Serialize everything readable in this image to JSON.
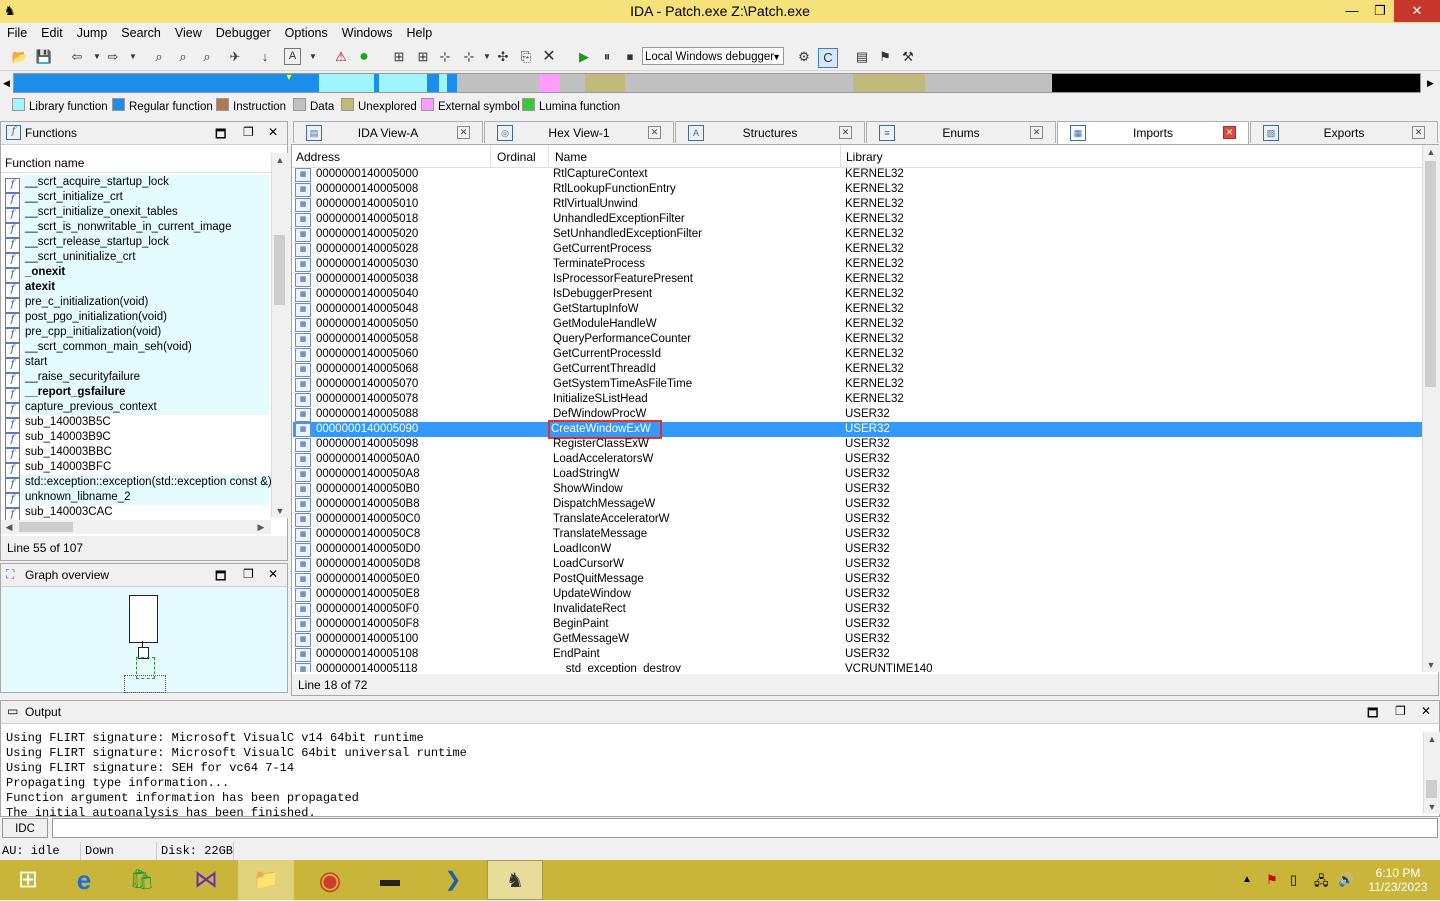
{
  "window": {
    "title": "IDA - Patch.exe Z:\\Patch.exe",
    "min": "—",
    "restore": "❐",
    "close": "✕"
  },
  "menu": [
    "File",
    "Edit",
    "Jump",
    "Search",
    "View",
    "Debugger",
    "Options",
    "Windows",
    "Help"
  ],
  "toolbar": {
    "debugger_select": "Local Windows debugger"
  },
  "legend": [
    {
      "label": "Library function",
      "color": "#9ff5ff"
    },
    {
      "label": "Regular function",
      "color": "#1a8ee8"
    },
    {
      "label": "Instruction",
      "color": "#b07a50"
    },
    {
      "label": "Data",
      "color": "#c0c0c0"
    },
    {
      "label": "Unexplored",
      "color": "#bfbb7a"
    },
    {
      "label": "External symbol",
      "color": "#ff9cff"
    },
    {
      "label": "Lumina function",
      "color": "#33cc33"
    }
  ],
  "functions_panel": {
    "title": "Functions",
    "column": "Function name",
    "items": [
      {
        "name": "__scrt_acquire_startup_lock",
        "bold": false,
        "lib": true
      },
      {
        "name": "__scrt_initialize_crt",
        "bold": false,
        "lib": true
      },
      {
        "name": "__scrt_initialize_onexit_tables",
        "bold": false,
        "lib": true
      },
      {
        "name": "__scrt_is_nonwritable_in_current_image",
        "bold": false,
        "lib": true
      },
      {
        "name": "__scrt_release_startup_lock",
        "bold": false,
        "lib": true
      },
      {
        "name": "__scrt_uninitialize_crt",
        "bold": false,
        "lib": true
      },
      {
        "name": "_onexit",
        "bold": true,
        "lib": true
      },
      {
        "name": "atexit",
        "bold": true,
        "lib": true
      },
      {
        "name": "pre_c_initialization(void)",
        "bold": false,
        "lib": true
      },
      {
        "name": "post_pgo_initialization(void)",
        "bold": false,
        "lib": true
      },
      {
        "name": "pre_cpp_initialization(void)",
        "bold": false,
        "lib": true
      },
      {
        "name": "__scrt_common_main_seh(void)",
        "bold": false,
        "lib": true
      },
      {
        "name": "start",
        "bold": false,
        "lib": true
      },
      {
        "name": "__raise_securityfailure",
        "bold": false,
        "lib": true
      },
      {
        "name": "__report_gsfailure",
        "bold": true,
        "lib": true
      },
      {
        "name": "capture_previous_context",
        "bold": false,
        "lib": true
      },
      {
        "name": "sub_140003B5C",
        "bold": false,
        "lib": false
      },
      {
        "name": "sub_140003B9C",
        "bold": false,
        "lib": false
      },
      {
        "name": "sub_140003BBC",
        "bold": false,
        "lib": false
      },
      {
        "name": "sub_140003BFC",
        "bold": false,
        "lib": false
      },
      {
        "name": "std::exception::exception(std::exception const &)",
        "bold": false,
        "lib": true
      },
      {
        "name": "unknown_libname_2",
        "bold": false,
        "lib": true
      },
      {
        "name": "sub_140003CAC",
        "bold": false,
        "lib": false
      }
    ],
    "status": "Line 55 of 107"
  },
  "graph_panel": {
    "title": "Graph overview"
  },
  "tabs": [
    {
      "label": "IDA View-A",
      "icon": "▤",
      "active": false
    },
    {
      "label": "Hex View-1",
      "icon": "◎",
      "active": false
    },
    {
      "label": "Structures",
      "icon": "A",
      "active": false
    },
    {
      "label": "Enums",
      "icon": "≡",
      "active": false
    },
    {
      "label": "Imports",
      "icon": "▦",
      "active": true
    },
    {
      "label": "Exports",
      "icon": "▧",
      "active": false
    }
  ],
  "imports": {
    "columns": [
      "Address",
      "Ordinal",
      "Name",
      "Library"
    ],
    "rows": [
      {
        "addr": "0000000140005000",
        "name": "RtlCaptureContext",
        "lib": "KERNEL32"
      },
      {
        "addr": "0000000140005008",
        "name": "RtlLookupFunctionEntry",
        "lib": "KERNEL32"
      },
      {
        "addr": "0000000140005010",
        "name": "RtlVirtualUnwind",
        "lib": "KERNEL32"
      },
      {
        "addr": "0000000140005018",
        "name": "UnhandledExceptionFilter",
        "lib": "KERNEL32"
      },
      {
        "addr": "0000000140005020",
        "name": "SetUnhandledExceptionFilter",
        "lib": "KERNEL32"
      },
      {
        "addr": "0000000140005028",
        "name": "GetCurrentProcess",
        "lib": "KERNEL32"
      },
      {
        "addr": "0000000140005030",
        "name": "TerminateProcess",
        "lib": "KERNEL32"
      },
      {
        "addr": "0000000140005038",
        "name": "IsProcessorFeaturePresent",
        "lib": "KERNEL32"
      },
      {
        "addr": "0000000140005040",
        "name": "IsDebuggerPresent",
        "lib": "KERNEL32"
      },
      {
        "addr": "0000000140005048",
        "name": "GetStartupInfoW",
        "lib": "KERNEL32"
      },
      {
        "addr": "0000000140005050",
        "name": "GetModuleHandleW",
        "lib": "KERNEL32"
      },
      {
        "addr": "0000000140005058",
        "name": "QueryPerformanceCounter",
        "lib": "KERNEL32"
      },
      {
        "addr": "0000000140005060",
        "name": "GetCurrentProcessId",
        "lib": "KERNEL32"
      },
      {
        "addr": "0000000140005068",
        "name": "GetCurrentThreadId",
        "lib": "KERNEL32"
      },
      {
        "addr": "0000000140005070",
        "name": "GetSystemTimeAsFileTime",
        "lib": "KERNEL32"
      },
      {
        "addr": "0000000140005078",
        "name": "InitializeSListHead",
        "lib": "KERNEL32"
      },
      {
        "addr": "0000000140005088",
        "name": "DefWindowProcW",
        "lib": "USER32"
      },
      {
        "addr": "0000000140005090",
        "name": "CreateWindowExW",
        "lib": "USER32",
        "selected": true
      },
      {
        "addr": "0000000140005098",
        "name": "RegisterClassExW",
        "lib": "USER32"
      },
      {
        "addr": "00000001400050A0",
        "name": "LoadAcceleratorsW",
        "lib": "USER32"
      },
      {
        "addr": "00000001400050A8",
        "name": "LoadStringW",
        "lib": "USER32"
      },
      {
        "addr": "00000001400050B0",
        "name": "ShowWindow",
        "lib": "USER32"
      },
      {
        "addr": "00000001400050B8",
        "name": "DispatchMessageW",
        "lib": "USER32"
      },
      {
        "addr": "00000001400050C0",
        "name": "TranslateAcceleratorW",
        "lib": "USER32"
      },
      {
        "addr": "00000001400050C8",
        "name": "TranslateMessage",
        "lib": "USER32"
      },
      {
        "addr": "00000001400050D0",
        "name": "LoadIconW",
        "lib": "USER32"
      },
      {
        "addr": "00000001400050D8",
        "name": "LoadCursorW",
        "lib": "USER32"
      },
      {
        "addr": "00000001400050E0",
        "name": "PostQuitMessage",
        "lib": "USER32"
      },
      {
        "addr": "00000001400050E8",
        "name": "UpdateWindow",
        "lib": "USER32"
      },
      {
        "addr": "00000001400050F0",
        "name": "InvalidateRect",
        "lib": "USER32"
      },
      {
        "addr": "00000001400050F8",
        "name": "BeginPaint",
        "lib": "USER32"
      },
      {
        "addr": "0000000140005100",
        "name": "GetMessageW",
        "lib": "USER32"
      },
      {
        "addr": "0000000140005108",
        "name": "EndPaint",
        "lib": "USER32"
      },
      {
        "addr": "0000000140005118",
        "name": "__std_exception_destroy",
        "lib": "VCRUNTIME140"
      }
    ],
    "status": "Line 18 of 72"
  },
  "output": {
    "title": "Output",
    "lines": [
      "Using FLIRT signature: Microsoft VisualC v14 64bit runtime",
      "Using FLIRT signature: Microsoft VisualC 64bit universal runtime",
      "Using FLIRT signature: SEH for vc64 7-14",
      "Propagating type information...",
      "Function argument information has been propagated",
      "The initial autoanalysis has been finished."
    ]
  },
  "idc": {
    "label": "IDC",
    "value": ""
  },
  "statusbar": {
    "au": "AU:  idle",
    "dir": "Down",
    "disk": "Disk: 22GB"
  },
  "clock": {
    "time": "6:10 PM",
    "date": "11/23/2023"
  }
}
